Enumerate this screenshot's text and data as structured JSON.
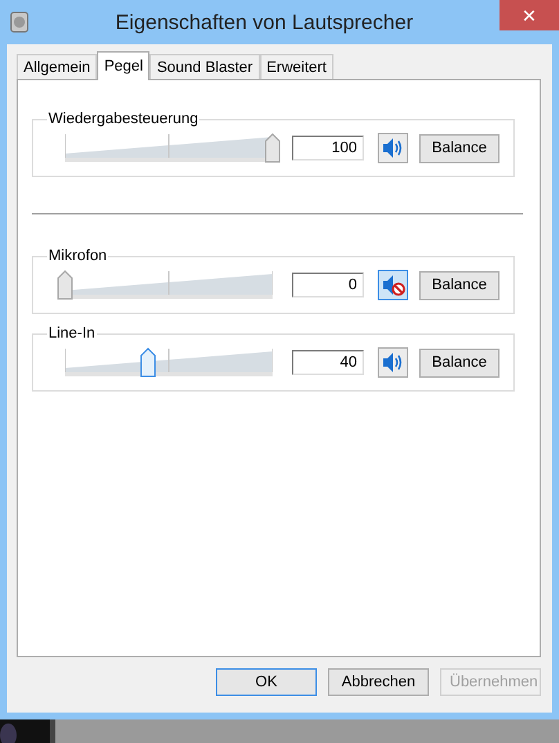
{
  "window": {
    "title": "Eigenschaften von Lautsprecher",
    "close": "✕"
  },
  "tabs": [
    {
      "label": "Allgemein",
      "selected": false
    },
    {
      "label": "Pegel",
      "selected": true
    },
    {
      "label": "Sound Blaster",
      "selected": false
    },
    {
      "label": "Erweitert",
      "selected": false
    }
  ],
  "channels": [
    {
      "name": "Wiedergabesteuerung",
      "level": 1,
      "value": "100",
      "muted": false,
      "focused": false,
      "balance": "Balance"
    },
    {
      "name": "Mikrofon",
      "level": 0,
      "value": "0",
      "muted": true,
      "focused": false,
      "balance": "Balance"
    },
    {
      "name": "Line-In",
      "level": 0.4,
      "value": "40",
      "muted": false,
      "focused": true,
      "balance": "Balance"
    }
  ],
  "buttons": [
    {
      "label": "OK",
      "disabled": false,
      "default": true
    },
    {
      "label": "Abbrechen",
      "disabled": false,
      "default": false
    },
    {
      "label": "Übernehmen",
      "disabled": true,
      "default": false
    }
  ]
}
